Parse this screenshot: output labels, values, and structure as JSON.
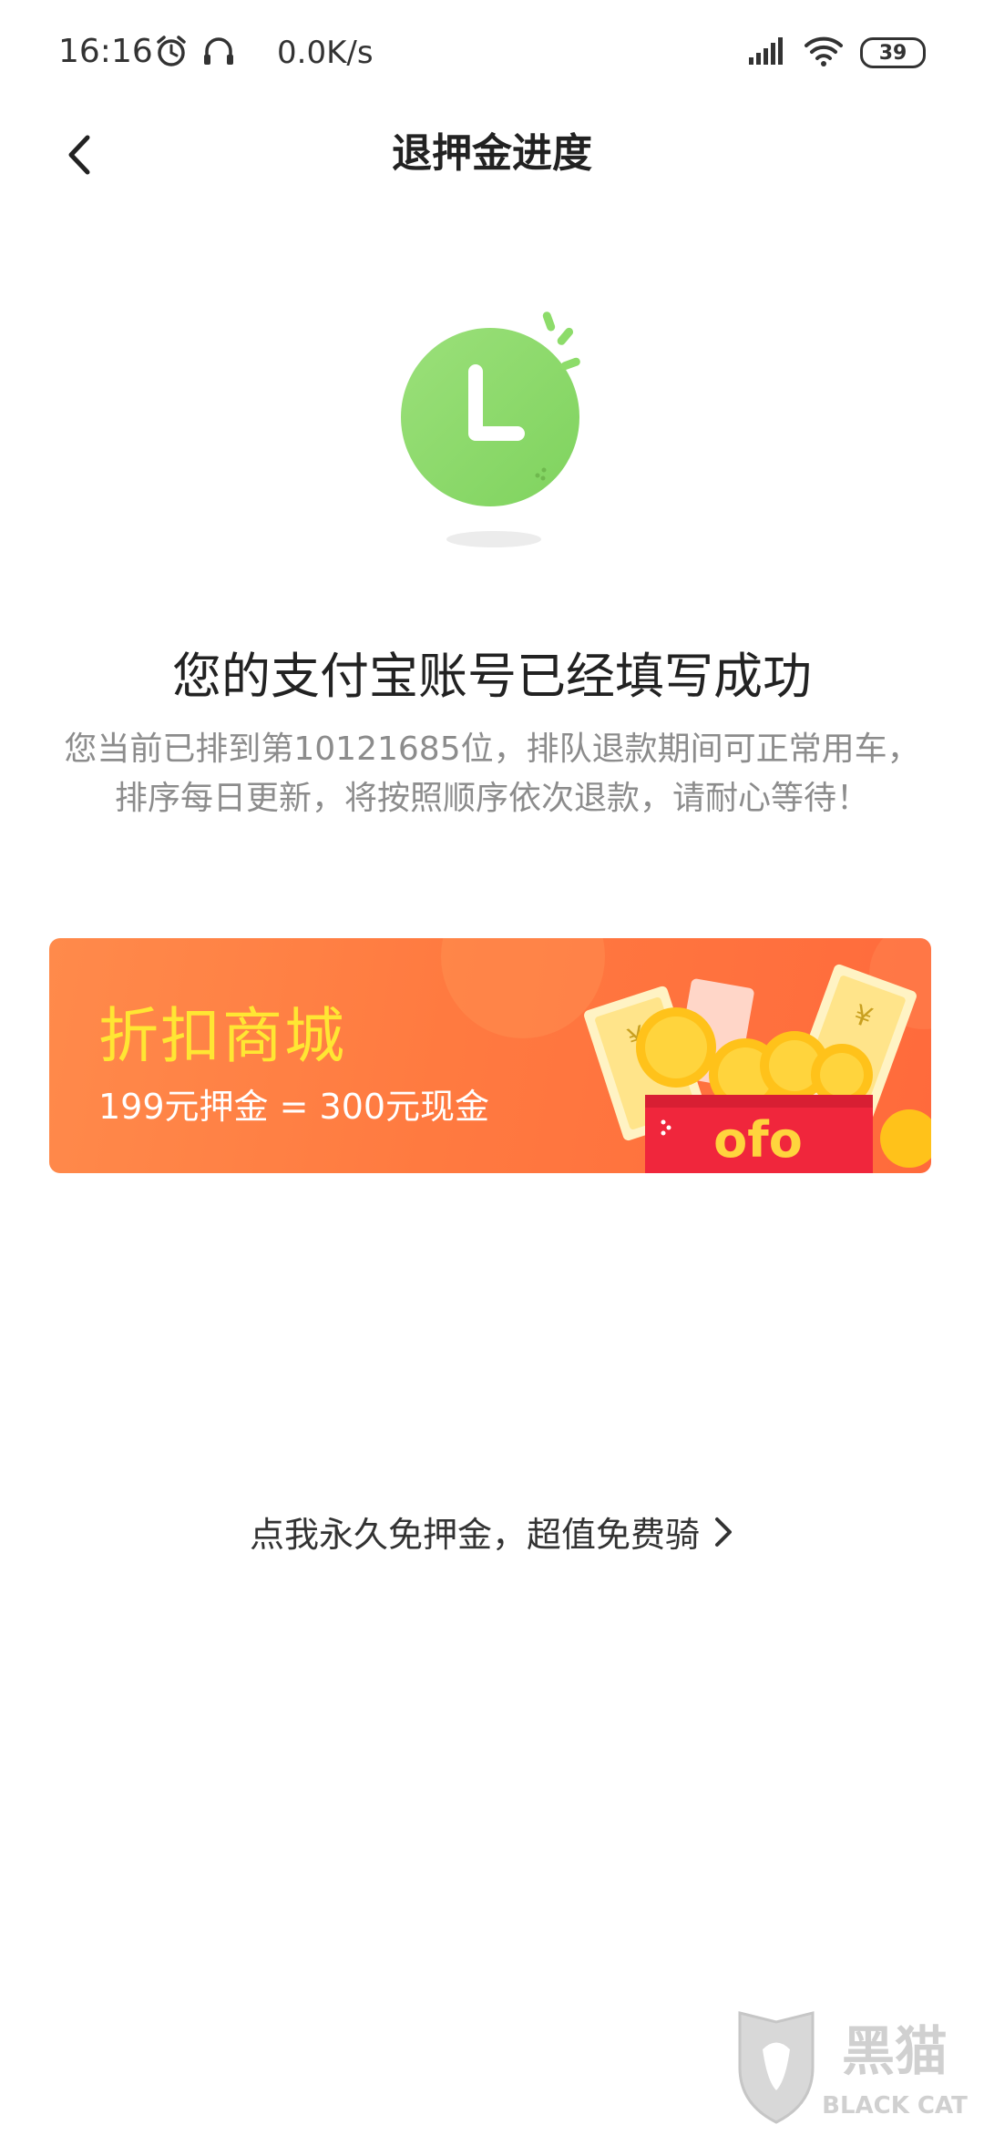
{
  "status_bar": {
    "time": "16:16",
    "network_speed": "0.0K/s",
    "battery": "39",
    "icons": [
      "alarm-icon",
      "headphones-icon",
      "signal-icon",
      "wifi-icon",
      "battery-icon"
    ]
  },
  "nav": {
    "title": "退押金进度",
    "back_icon": "chevron-left-icon"
  },
  "status": {
    "illustration": "clock-icon",
    "title": "您的支付宝账号已经填写成功",
    "description": "您当前已排到第10121685位，排队退款期间可正常用车，排序每日更新，将按照顺序依次退款，请耐心等待！"
  },
  "banner": {
    "title": "折扣商城",
    "subtitle": "199元押金 = 300元现金",
    "brand": "ofo"
  },
  "free_deposit_link": {
    "label": "点我永久免押金，超值免费骑",
    "icon": "chevron-right-icon"
  },
  "watermark": {
    "brand_cn": "黑猫",
    "brand_en": "BLACK CAT"
  },
  "colors": {
    "clock_green": "#8ddc6a",
    "banner_orange": "#ff7a40",
    "banner_title": "#ffe633",
    "red_packet": "#f0263c"
  }
}
